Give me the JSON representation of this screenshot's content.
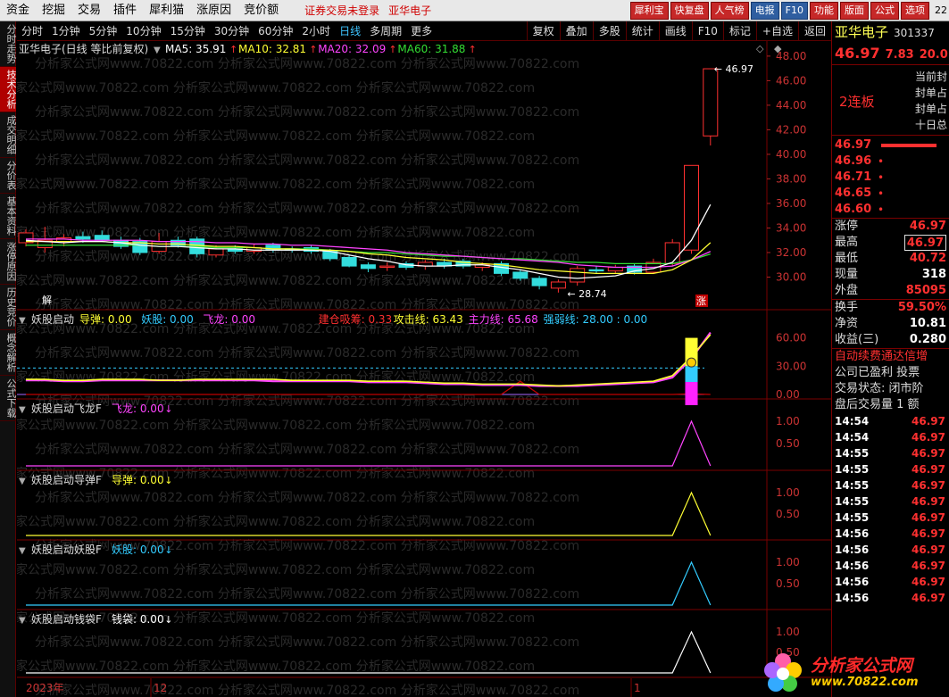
{
  "menu": [
    "资金",
    "挖掘",
    "交易",
    "插件",
    "犀利猫",
    "涨原因",
    "竞价额"
  ],
  "menu_status": "证券交易未登录",
  "menu_stock": "亚华电子",
  "topbuttons": [
    "犀利宝",
    "快复盘",
    "人气榜",
    "电报",
    "F10",
    "功能",
    "版面",
    "公式",
    "选项"
  ],
  "clock": "22",
  "lefttabs": [
    "分时走势",
    "技术分析",
    "成交明细",
    "分价表",
    "基本资料",
    "涨停原因",
    "历史竞价",
    "概念解析",
    "公式下载"
  ],
  "periods": [
    "分时",
    "1分钟",
    "5分钟",
    "10分钟",
    "15分钟",
    "30分钟",
    "60分钟",
    "2小时",
    "日线",
    "多周期",
    "更多"
  ],
  "active_period": "日线",
  "tools": [
    "复权",
    "叠加",
    "多股",
    "统计",
    "画线",
    "F10",
    "标记",
    "+自选",
    "返回"
  ],
  "main_title": "亚华电子(日线 等比前复权)",
  "ma": [
    {
      "label": "MA5: 35.91",
      "color": "#ffffff"
    },
    {
      "label": "MA10: 32.81",
      "color": "#ffff33"
    },
    {
      "label": "MA20: 32.09",
      "color": "#ff44ff"
    },
    {
      "label": "MA60: 31.88",
      "color": "#33dd33"
    }
  ],
  "high_label": "46.97",
  "low_label": "28.74",
  "jie": "解",
  "zhang": "涨",
  "indicator1": {
    "title": "妖股启动",
    "items": [
      {
        "label": "导弹: 0.00",
        "color": "#ffff33"
      },
      {
        "label": "妖股: 0.00",
        "color": "#33ccff"
      },
      {
        "label": "飞龙: 0.00",
        "color": "#ff44ff"
      },
      {
        "label": "建仓吸筹: 0.33",
        "color": "#ff3030"
      },
      {
        "label": "攻击线: 63.43",
        "color": "#ffff33"
      },
      {
        "label": "主力线: 65.68",
        "color": "#ff44ff"
      },
      {
        "label": "强弱线: 28.00 : 0.00",
        "color": "#33ccff"
      }
    ],
    "axis": [
      "60.00",
      "30.00",
      "0.00"
    ]
  },
  "sub_panels": [
    {
      "title": "妖股启动飞龙F",
      "label": "飞龙: 0.00",
      "color": "#ff44ff",
      "axis": [
        "1.00",
        "0.50"
      ]
    },
    {
      "title": "妖股启动导弹F",
      "label": "导弹: 0.00",
      "color": "#ffff33",
      "axis": [
        "1.00",
        "0.50"
      ]
    },
    {
      "title": "妖股启动妖股F",
      "label": "妖股: 0.00",
      "color": "#33ccff",
      "axis": [
        "1.00",
        "0.50"
      ]
    },
    {
      "title": "妖股启动钱袋F",
      "label": "钱袋: 0.00",
      "color": "#ffffff",
      "axis": [
        "1.00",
        "0.50"
      ]
    }
  ],
  "price_axis": [
    "48.00",
    "46.00",
    "44.00",
    "42.00",
    "40.00",
    "38.00",
    "36.00",
    "34.00",
    "32.00",
    "30.00"
  ],
  "date_labels": [
    "2023年",
    "12",
    "1"
  ],
  "watermark": "分析家公式网www.70822.com",
  "right": {
    "name": "亚华电子",
    "code": "301337",
    "price": "46.97",
    "change": "7.83",
    "pct": "20.0",
    "lianban": "2连板",
    "board_items": [
      "当前封",
      "封单占",
      "封单占",
      "十日总"
    ],
    "bids": [
      "46.97",
      "46.96",
      "46.71",
      "46.65",
      "46.60"
    ],
    "stats": [
      {
        "k": "涨停",
        "v": "46.97"
      },
      {
        "k": "最高",
        "v": "46.97"
      },
      {
        "k": "最低",
        "v": "40.72"
      },
      {
        "k": "现量",
        "v": "318"
      },
      {
        "k": "外盘",
        "v": "85095"
      }
    ],
    "stats2": [
      {
        "k": "换手",
        "v": "59.50%"
      },
      {
        "k": "净资",
        "v": "10.81"
      },
      {
        "k": "收益(三)",
        "v": "0.280"
      }
    ],
    "info": [
      "自动续费通达信增",
      "公司已盈利 投票",
      "交易状态: 闭市阶",
      "盘后交易量 1 额"
    ],
    "ticks": [
      {
        "t": "14:54",
        "p": "46.97"
      },
      {
        "t": "14:54",
        "p": "46.97"
      },
      {
        "t": "14:55",
        "p": "46.97"
      },
      {
        "t": "14:55",
        "p": "46.97"
      },
      {
        "t": "14:55",
        "p": "46.97"
      },
      {
        "t": "14:55",
        "p": "46.97"
      },
      {
        "t": "14:55",
        "p": "46.97"
      },
      {
        "t": "14:56",
        "p": "46.97"
      },
      {
        "t": "14:56",
        "p": "46.97"
      },
      {
        "t": "14:56",
        "p": "46.97"
      },
      {
        "t": "14:56",
        "p": "46.97"
      },
      {
        "t": "14:56",
        "p": "46.97"
      }
    ]
  },
  "logo": {
    "line1": "分析家公式网",
    "line2": "www.70822.com"
  },
  "chart_data": {
    "type": "candlestick",
    "ylim": [
      28,
      48.5
    ],
    "candles": [
      {
        "o": 32.8,
        "c": 33.6,
        "h": 33.9,
        "l": 32.5
      },
      {
        "o": 32.4,
        "c": 33.0,
        "h": 34.1,
        "l": 32.0
      },
      {
        "o": 32.9,
        "c": 33.2,
        "h": 33.5,
        "l": 32.5
      },
      {
        "o": 33.3,
        "c": 33.1,
        "h": 33.7,
        "l": 32.8
      },
      {
        "o": 33.4,
        "c": 33.0,
        "h": 33.8,
        "l": 32.9
      },
      {
        "o": 33.0,
        "c": 32.5,
        "h": 33.3,
        "l": 32.3
      },
      {
        "o": 32.9,
        "c": 32.0,
        "h": 33.2,
        "l": 31.8
      },
      {
        "o": 32.1,
        "c": 32.9,
        "h": 33.6,
        "l": 31.9
      },
      {
        "o": 33.0,
        "c": 32.6,
        "h": 33.3,
        "l": 32.4
      },
      {
        "o": 33.1,
        "c": 31.9,
        "h": 33.3,
        "l": 31.6
      },
      {
        "o": 31.8,
        "c": 32.3,
        "h": 32.6,
        "l": 31.6
      },
      {
        "o": 32.3,
        "c": 32.1,
        "h": 32.6,
        "l": 31.9
      },
      {
        "o": 32.1,
        "c": 32.4,
        "h": 32.7,
        "l": 31.9
      },
      {
        "o": 32.6,
        "c": 32.2,
        "h": 32.8,
        "l": 32.0
      },
      {
        "o": 32.3,
        "c": 32.2,
        "h": 32.5,
        "l": 32.0
      },
      {
        "o": 32.4,
        "c": 32.1,
        "h": 32.6,
        "l": 31.9
      },
      {
        "o": 32.1,
        "c": 31.5,
        "h": 32.3,
        "l": 31.3
      },
      {
        "o": 31.6,
        "c": 30.9,
        "h": 31.8,
        "l": 30.8
      },
      {
        "o": 31.0,
        "c": 30.7,
        "h": 31.2,
        "l": 30.4
      },
      {
        "o": 30.8,
        "c": 30.9,
        "h": 31.2,
        "l": 30.5
      },
      {
        "o": 31.1,
        "c": 30.8,
        "h": 31.3,
        "l": 30.6
      },
      {
        "o": 30.9,
        "c": 31.2,
        "h": 31.4,
        "l": 30.6
      },
      {
        "o": 31.2,
        "c": 30.9,
        "h": 31.5,
        "l": 30.7
      },
      {
        "o": 31.3,
        "c": 30.9,
        "h": 31.5,
        "l": 30.7
      },
      {
        "o": 30.8,
        "c": 31.0,
        "h": 31.2,
        "l": 30.5
      },
      {
        "o": 31.1,
        "c": 30.3,
        "h": 31.3,
        "l": 30.1
      },
      {
        "o": 30.4,
        "c": 29.9,
        "h": 30.6,
        "l": 29.7
      },
      {
        "o": 29.9,
        "c": 29.3,
        "h": 30.1,
        "l": 29.0
      },
      {
        "o": 29.1,
        "c": 29.6,
        "h": 29.8,
        "l": 28.74
      },
      {
        "o": 29.6,
        "c": 30.7,
        "h": 30.9,
        "l": 29.3
      },
      {
        "o": 30.6,
        "c": 30.5,
        "h": 30.9,
        "l": 30.3
      },
      {
        "o": 30.5,
        "c": 30.8,
        "h": 31.0,
        "l": 30.3
      },
      {
        "o": 30.9,
        "c": 30.4,
        "h": 31.1,
        "l": 30.2
      },
      {
        "o": 30.4,
        "c": 31.2,
        "h": 31.5,
        "l": 30.3
      },
      {
        "o": 31.1,
        "c": 32.8,
        "h": 33.1,
        "l": 30.9
      },
      {
        "o": 32.2,
        "c": 39.1,
        "h": 39.1,
        "l": 31.9
      },
      {
        "o": 41.5,
        "c": 46.97,
        "h": 46.97,
        "l": 40.72
      }
    ],
    "ma5": [
      33.0,
      32.9,
      32.8,
      32.9,
      32.9,
      32.8,
      32.6,
      32.5,
      32.5,
      32.4,
      32.3,
      32.3,
      32.2,
      32.2,
      32.2,
      32.2,
      32.1,
      31.8,
      31.5,
      31.3,
      31.0,
      30.9,
      30.9,
      31.0,
      31.0,
      30.8,
      30.6,
      30.3,
      30.0,
      29.9,
      30.0,
      30.1,
      30.5,
      30.7,
      31.2,
      33.0,
      35.91
    ],
    "ma10": [
      32.9,
      32.9,
      32.9,
      32.9,
      32.9,
      32.8,
      32.8,
      32.7,
      32.7,
      32.6,
      32.5,
      32.5,
      32.4,
      32.3,
      32.3,
      32.2,
      32.2,
      32.1,
      31.9,
      31.8,
      31.6,
      31.5,
      31.4,
      31.2,
      31.1,
      31.0,
      30.8,
      30.6,
      30.5,
      30.4,
      30.3,
      30.3,
      30.3,
      30.3,
      30.6,
      31.4,
      32.81
    ],
    "ma20": [
      33.1,
      33.1,
      33.1,
      33.0,
      33.0,
      33.0,
      33.0,
      32.9,
      32.9,
      32.9,
      32.8,
      32.8,
      32.7,
      32.7,
      32.6,
      32.6,
      32.5,
      32.4,
      32.3,
      32.2,
      32.0,
      31.9,
      31.8,
      31.7,
      31.6,
      31.5,
      31.4,
      31.3,
      31.2,
      31.0,
      30.9,
      30.8,
      30.8,
      30.8,
      30.9,
      31.4,
      32.09
    ],
    "ma60": [
      32.6,
      32.6,
      32.6,
      32.6,
      32.6,
      32.6,
      32.6,
      32.5,
      32.5,
      32.5,
      32.4,
      32.4,
      32.4,
      32.3,
      32.3,
      32.3,
      32.2,
      32.1,
      32.0,
      32.0,
      31.9,
      31.8,
      31.7,
      31.7,
      31.6,
      31.5,
      31.5,
      31.4,
      31.3,
      31.2,
      31.2,
      31.1,
      31.1,
      31.1,
      31.1,
      31.4,
      31.88
    ],
    "attack": [
      16,
      16,
      15,
      15,
      16,
      16,
      16,
      15,
      15,
      16,
      16,
      16,
      16,
      16,
      15,
      15,
      15,
      15,
      14,
      14,
      14,
      13,
      12,
      12,
      11,
      11,
      11,
      10,
      9,
      10,
      11,
      12,
      13,
      14,
      20,
      40,
      63.43
    ],
    "main": [
      15,
      15,
      14,
      14,
      15,
      15,
      15,
      15,
      15,
      15,
      15,
      15,
      15,
      14,
      14,
      14,
      14,
      14,
      13,
      13,
      13,
      12,
      11,
      11,
      10,
      10,
      10,
      9,
      9,
      9,
      10,
      11,
      12,
      13,
      18,
      38,
      65.68
    ],
    "strong": 28.0,
    "build": [
      0,
      0,
      0,
      0,
      0,
      0,
      0,
      0,
      0,
      0,
      0,
      0,
      0,
      0,
      0,
      0,
      0,
      0,
      0,
      0,
      0,
      0,
      0,
      0,
      0,
      0,
      7,
      0,
      0,
      0,
      0,
      0,
      0,
      0,
      0,
      0.33,
      0
    ],
    "signal": [
      0,
      0,
      0,
      0,
      0,
      0,
      0,
      0,
      0,
      0,
      0,
      0,
      0,
      0,
      0,
      0,
      0,
      0,
      0,
      0,
      0,
      0,
      0,
      0,
      0,
      0,
      0,
      0,
      0,
      0,
      0,
      0,
      0,
      0,
      0,
      1,
      0
    ]
  }
}
